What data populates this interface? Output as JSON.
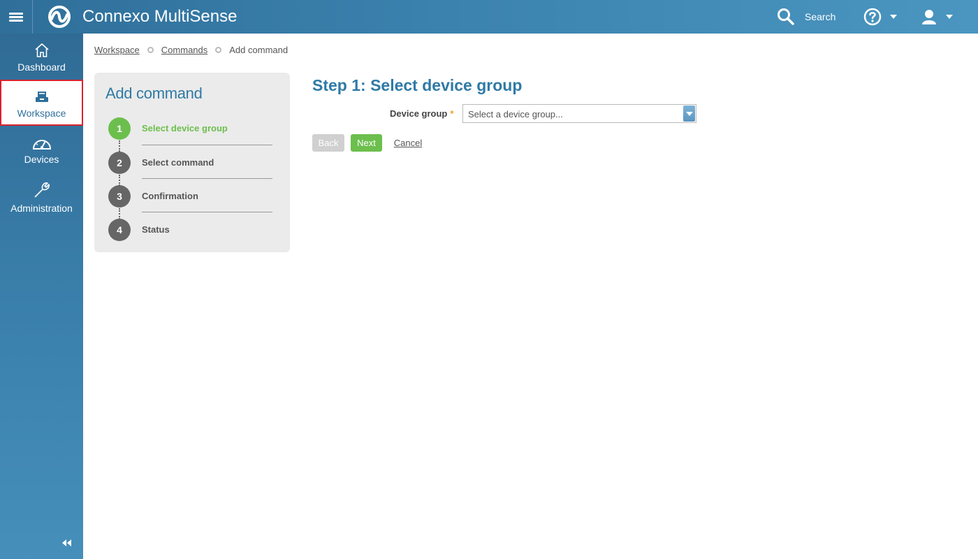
{
  "header": {
    "app_title": "Connexo MultiSense",
    "search_label": "Search",
    "menu_icon": "hamburger-icon",
    "logo_icon": "connexo-logo",
    "help_icon": "question-circle-icon",
    "user_icon": "user-icon"
  },
  "sidebar": {
    "items": [
      {
        "label": "Dashboard",
        "icon": "home-icon"
      },
      {
        "label": "Workspace",
        "icon": "workspace-icon",
        "active": true
      },
      {
        "label": "Devices",
        "icon": "gauge-icon"
      },
      {
        "label": "Administration",
        "icon": "wrench-icon"
      }
    ],
    "collapse_icon": "double-chevron-left-icon"
  },
  "breadcrumb": {
    "items": [
      "Workspace",
      "Commands",
      "Add command"
    ]
  },
  "wizard": {
    "title": "Add command",
    "steps": [
      {
        "number": "1",
        "label": "Select device group",
        "active": true
      },
      {
        "number": "2",
        "label": "Select command"
      },
      {
        "number": "3",
        "label": "Confirmation"
      },
      {
        "number": "4",
        "label": "Status"
      }
    ]
  },
  "main": {
    "heading": "Step 1: Select device group",
    "device_group_label": "Device group",
    "required_mark": "*",
    "device_group_placeholder": "Select a device group...",
    "back_label": "Back",
    "next_label": "Next",
    "cancel_label": "Cancel"
  },
  "colors": {
    "accent": "#2f7aa6",
    "active_step": "#6cbf4d",
    "header_start": "#2f6f9a",
    "header_end": "#4a96c0",
    "active_highlight": "#d9232e"
  }
}
